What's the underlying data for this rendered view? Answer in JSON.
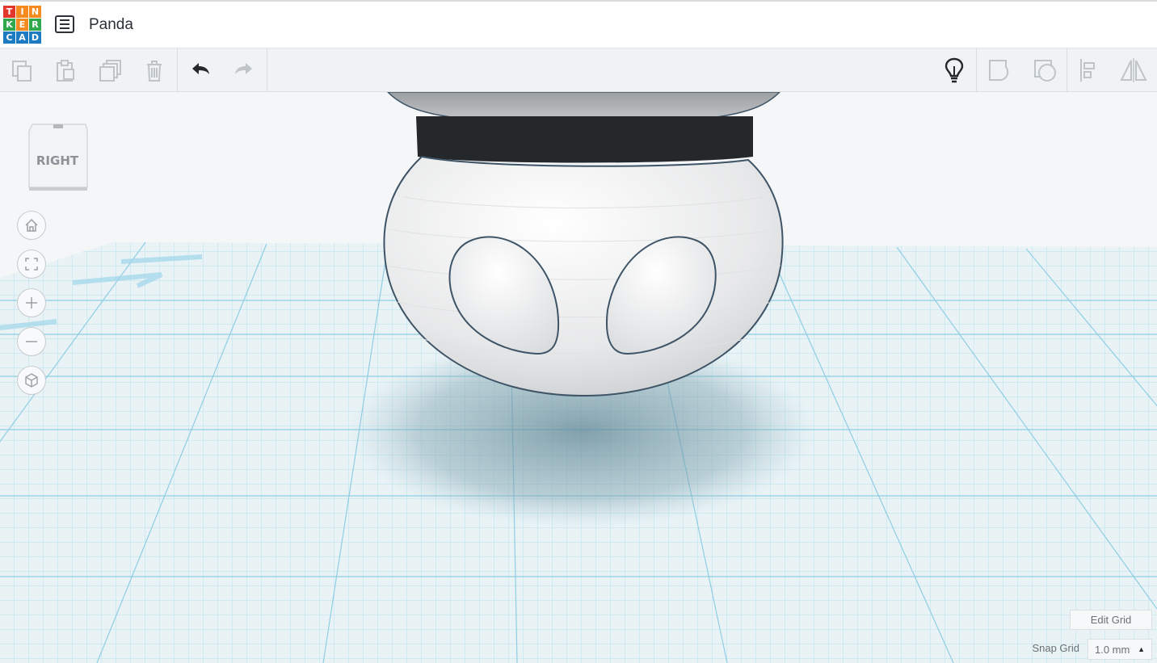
{
  "app": {
    "logo_letters": [
      "T",
      "I",
      "N",
      "K",
      "E",
      "R",
      "C",
      "A",
      "D"
    ],
    "logo_colors": [
      "#e2382c",
      "#f58a1f",
      "#f58a1f",
      "#2ea84a",
      "#f58a1f",
      "#2ea84a",
      "#1d7bc1",
      "#1d7bc1",
      "#1d7bc1"
    ],
    "project_title": "Panda"
  },
  "toolbar": {
    "left_tools": [
      "copy-icon",
      "paste-icon",
      "duplicate-icon",
      "delete-icon",
      "undo-icon",
      "redo-icon"
    ],
    "right_tools": [
      "lightbulb-icon",
      "shape-group-icon",
      "shape-ungroup-icon",
      "align-icon",
      "mirror-icon"
    ]
  },
  "viewcube": {
    "face_label": "RIGHT"
  },
  "nav_controls": [
    "home-icon",
    "fit-view-icon",
    "zoom-in-icon",
    "zoom-out-icon",
    "perspective-icon"
  ],
  "grid_controls": {
    "edit_grid_label": "Edit Grid",
    "snap_grid_label": "Snap Grid",
    "snap_value": "1.0 mm"
  },
  "colors": {
    "workplane_blue": "#9fd6ea",
    "accent_dark": "#25282b"
  }
}
